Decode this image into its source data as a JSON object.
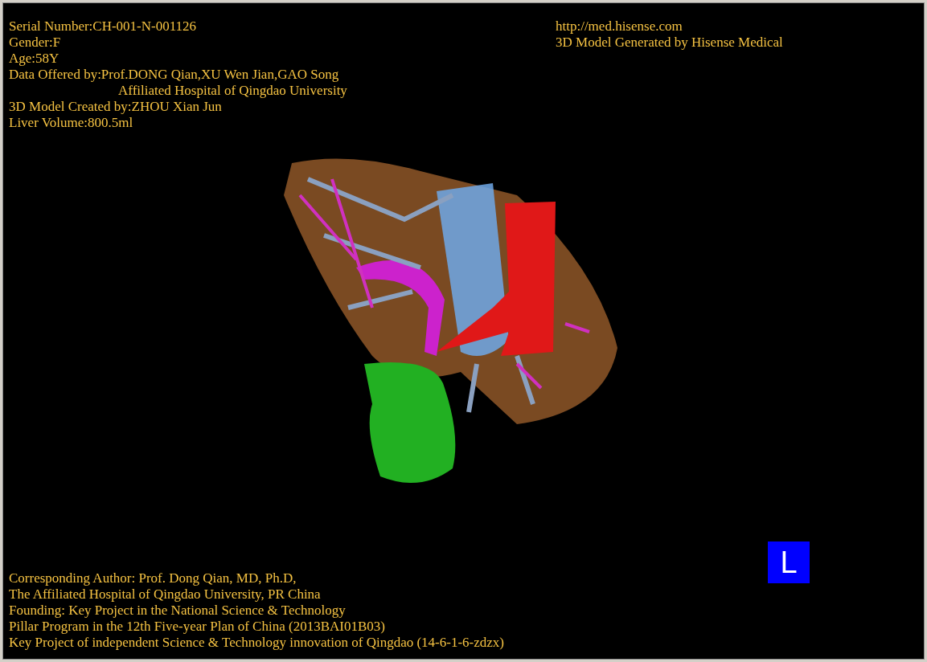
{
  "info_top_left": [
    {
      "text": "Serial Number:CH-001-N-001126",
      "kind": "line"
    },
    {
      "text": "Gender:F",
      "kind": "line"
    },
    {
      "text": "Age:58Y",
      "kind": "line"
    },
    {
      "text": "Data Offered by:Prof.DONG Qian,XU Wen Jian,GAO Song",
      "kind": "line"
    },
    {
      "text": "Affiliated Hospital of Qingdao University",
      "kind": "continuation"
    },
    {
      "text": "3D Model Created by:ZHOU Xian Jun",
      "kind": "line"
    },
    {
      "text": "Liver Volume:800.5ml",
      "kind": "line"
    }
  ],
  "info_top_right": [
    {
      "text": "http://med.hisense.com"
    },
    {
      "text": "3D Model Generated by Hisense Medical"
    }
  ],
  "model": {
    "kind": "organ"
  },
  "orientation_marker": "L",
  "info_bottom_left": [
    {
      "text": "Corresponding Author: Prof. Dong Qian, MD, Ph.D,"
    },
    {
      "text": "The Affiliated Hospital of Qingdao University, PR China"
    },
    {
      "text": "Founding: Key Project in the National Science & Technology"
    },
    {
      "text": "Pillar Program in the 12th Five-year Plan of China (2013BAI01B03)"
    },
    {
      "text": "Key Project of independent Science & Technology innovation of Qingdao (14-6-1-6-zdzx)"
    }
  ]
}
